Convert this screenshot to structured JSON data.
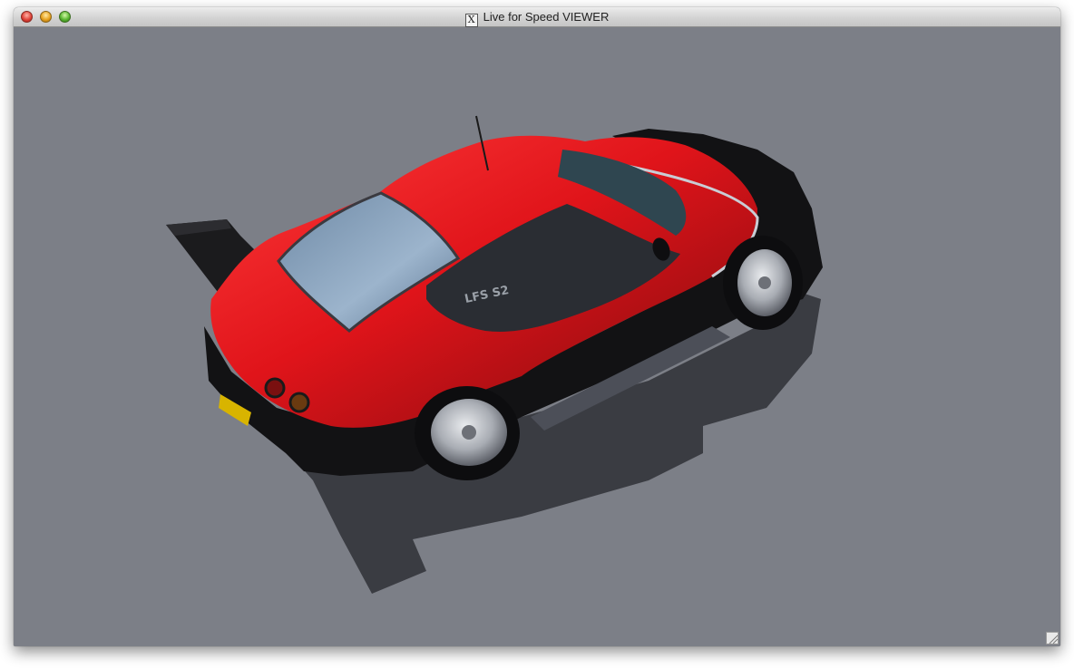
{
  "window": {
    "title": "Live for Speed VIEWER",
    "x11_icon": "X",
    "controls": {
      "close": "close-button",
      "minimize": "minimize-button",
      "zoom": "zoom-button"
    }
  },
  "viewport": {
    "background_color": "#7c7f87",
    "car": {
      "body_color": "#d4151b",
      "lower_color": "#121214",
      "window_color": "#8ea6c0",
      "wheel_color": "#b9bcc2",
      "shadow_color": "#2e2f34",
      "sticker_text": "LFS S2"
    }
  },
  "resize_grip": {
    "icon": "resize-grip-icon"
  }
}
